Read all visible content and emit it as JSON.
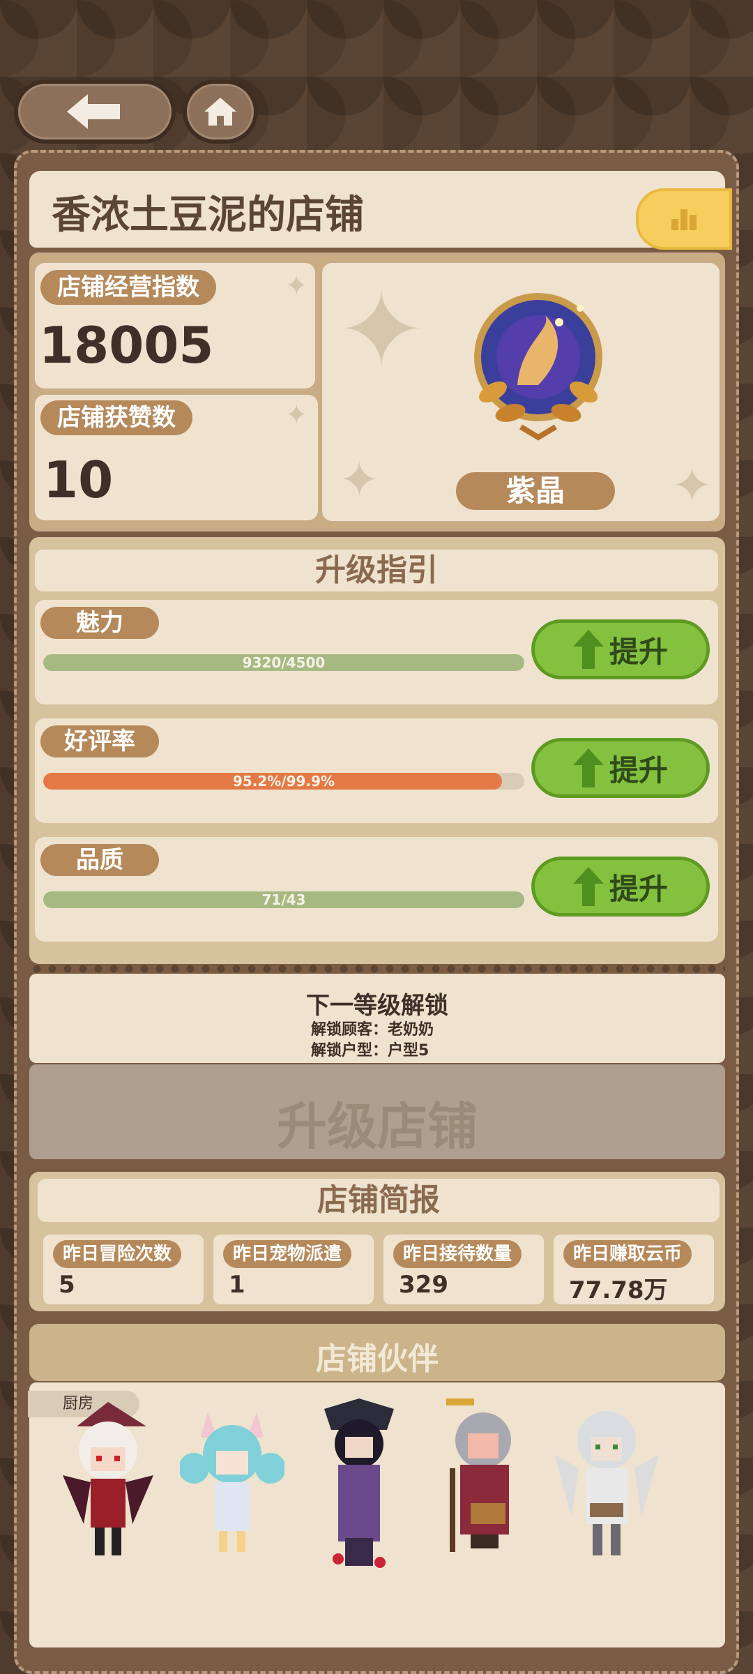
{
  "shop": {
    "title": "香浓土豆泥的店铺",
    "business_index_label": "店铺经营指数",
    "business_index_value": "18005",
    "likes_label": "店铺获赞数",
    "likes_value": "10",
    "tier": "紫晶"
  },
  "guide": {
    "title": "升级指引",
    "rows": [
      {
        "label": "魅力",
        "progress_text": "9320/4500",
        "progress": 1.0,
        "bar_color": "#a7b983",
        "button": "提升"
      },
      {
        "label": "好评率",
        "progress_text": "95.2%/99.9%",
        "progress": 0.953,
        "bar_color": "#e37a45",
        "button": "提升"
      },
      {
        "label": "品质",
        "progress_text": "71/43",
        "progress": 1.0,
        "bar_color": "#a7b983",
        "button": "提升"
      }
    ]
  },
  "next_level": {
    "title": "下一等级解锁",
    "line1": "解锁顾客：老奶奶",
    "line2": "解锁户型：户型5",
    "upgrade_button": "升级店铺"
  },
  "report": {
    "title": "店铺简报",
    "items": [
      {
        "label": "昨日冒险次数",
        "value": "5"
      },
      {
        "label": "昨日宠物派遣",
        "value": "1"
      },
      {
        "label": "昨日接待数量",
        "value": "329"
      },
      {
        "label": "昨日赚取云币",
        "value": "77.78万"
      }
    ]
  },
  "partners": {
    "title": "店铺伙伴",
    "tag": "厨房",
    "characters": [
      "demon-girl",
      "cat-girl",
      "dark-mage",
      "old-lady",
      "winged-knight"
    ]
  },
  "colors": {
    "background": "#5a4433",
    "panel": "#efe3cf",
    "accent_label": "#b5895a",
    "green_button": "#84c13e",
    "orange_bar": "#e37a45"
  }
}
